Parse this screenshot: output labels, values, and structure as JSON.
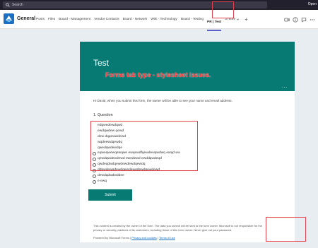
{
  "topbar": {
    "search_placeholder": "Search",
    "open_label": "Open"
  },
  "header": {
    "channel": "General",
    "tabs": [
      "Posts",
      "Files",
      "Board - Management",
      "Vendor Contacts",
      "Board - Network",
      "Wiki - Technology",
      "Board - Testing"
    ],
    "active_tab": "PR | Test",
    "more_label": "3 more",
    "add_label": "+"
  },
  "form": {
    "title": "Test",
    "annotation": "Forms tab type - stylesheet issues.",
    "banner_menu": "...",
    "intro": "Hi David, when you submit this form, the owner will be able to see your name and email address.",
    "question": "1. Question",
    "options": [
      "edqwedewdqwd",
      "ewdqwdew qewd",
      "dew dqqewwdewd",
      "wqdeewdqewdq",
      "qwedqwdewdqe",
      "eqweqwewqewqwe ewqewdfqewdewqwdwq ewqd ew",
      "qewdqwdewdewd ewedewd ewddqwdeqd",
      "qwdeqdwdqewdewdewdqewdq",
      "ddewdewgdewdqewdewqdewdqewdewd",
      "dewdqdwdwddee",
      "e ewq"
    ],
    "option_has_radio": [
      false,
      false,
      false,
      false,
      false,
      true,
      true,
      true,
      true,
      true,
      true
    ],
    "submit_label": "Submit",
    "footer_note": "This content is created by the owner of the form. The data you submit will be sent to the form owner. Microsoft is not responsible for the privacy or security practices of its customers, including those of this form owner. Never give out your password.",
    "powered_by": "Powered by Microsoft Forms |",
    "privacy_link": "Privacy and cookies",
    "separator": "|",
    "terms_link": "Terms of use"
  },
  "colors": {
    "accent": "#077a74",
    "highlight": "#e3424e",
    "annotation": "#ff3b3b",
    "teams_purple": "#5b5fc7"
  }
}
